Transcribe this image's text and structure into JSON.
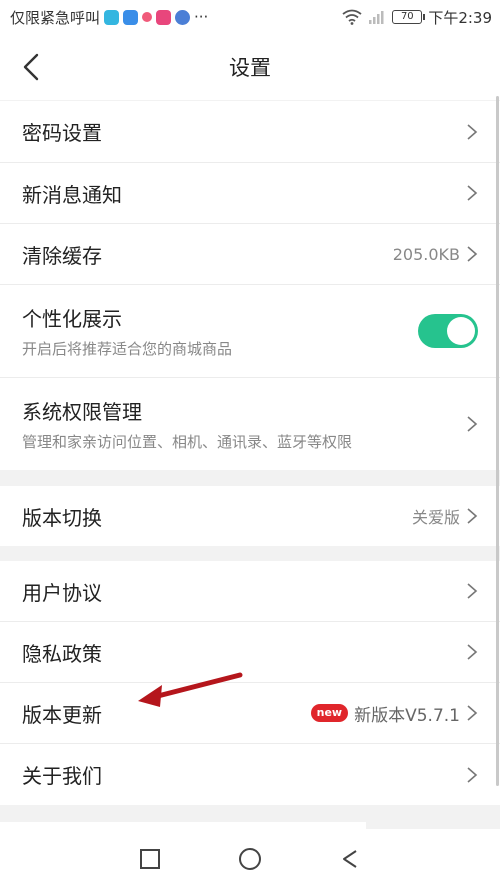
{
  "status_bar": {
    "left_text": "仅限紧急呼叫",
    "more": "···",
    "battery": "70",
    "time": "下午2:39"
  },
  "header": {
    "title": "设置",
    "back_icon": "chevron-left-icon"
  },
  "groups": [
    {
      "items": [
        {
          "label": "密码设置"
        },
        {
          "label": "新消息通知"
        },
        {
          "label": "清除缓存",
          "value": "205.0KB"
        },
        {
          "label": "个性化展示",
          "sub": "开启后将推荐适合您的商城商品",
          "toggle": true
        },
        {
          "label": "系统权限管理",
          "sub": "管理和家亲访问位置、相机、通讯录、蓝牙等权限"
        }
      ]
    },
    {
      "items": [
        {
          "label": "版本切换",
          "value": "关爱版"
        }
      ]
    },
    {
      "items": [
        {
          "label": "用户协议"
        },
        {
          "label": "隐私政策"
        },
        {
          "label": "版本更新",
          "badge": "new",
          "value": "新版本V5.7.1"
        },
        {
          "label": "关于我们"
        }
      ]
    }
  ],
  "colors": {
    "toggle_on": "#26c38e",
    "badge": "#e0262b",
    "annotation_arrow": "#b5161c"
  }
}
